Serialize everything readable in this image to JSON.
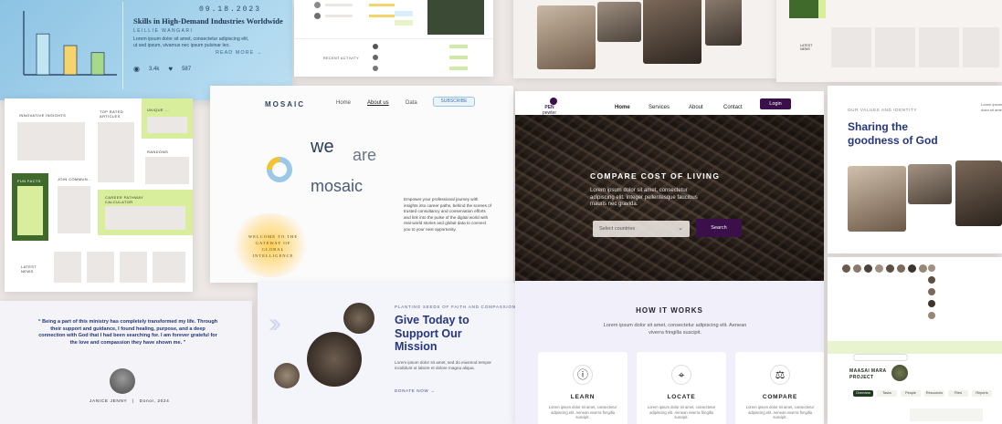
{
  "colors": {
    "navy": "#27367c",
    "plum": "#3a0f4a",
    "lime": "#d9ee9c",
    "forest": "#3f6a2b",
    "sky": "#8cc3e3",
    "amber": "#ffd15a"
  },
  "article_card": {
    "date": "09.18.2023",
    "title": "Skills in High-Demand Industries Worldwide",
    "author": "LEILLIE WANGARI",
    "excerpt": "Lorem ipsum dolor sit amet, consectetur adipiscing elit, ut sed ipsum, vivamus nec ipsum pulvinar leo.",
    "read_more": "READ MORE",
    "views": "3.4k",
    "likes": "587",
    "chart_bars": [
      {
        "name": "bar-teal",
        "level": 0.7,
        "color": "#bfe6f2"
      },
      {
        "name": "bar-yellow",
        "level": 0.5,
        "color": "#f6d46b"
      },
      {
        "name": "bar-green",
        "level": 0.38,
        "color": "#a8d88a"
      }
    ]
  },
  "dashboard_top": {
    "section_label": "RECENT ACTIVITY"
  },
  "left_grid": {
    "labels": [
      "INNOVATIVE INSIGHTS",
      "TOP RATED ARTICLES",
      "UNIQUE ...",
      "FUN FACTS",
      "JOIN COMMUN...",
      "RANDOMS",
      "CAREER PATHWAY CALCULATOR",
      "LATEST NEWS"
    ]
  },
  "mosaic": {
    "logo": "MOSAIC",
    "nav": [
      "Home",
      "About us",
      "Data"
    ],
    "subscribe": "SUBSCRIBE",
    "headline_we": "we",
    "headline_are": "are",
    "headline_mosaic": "mosaic",
    "body": "Empower your professional journey with insights into career paths, behind the scenes of trusted consultancy and conservation efforts and link into the pulse of the digital world with real-world stories and global data to connect you to your next opportunity.",
    "welcome": "WELCOME TO THE GATEWAY OF GLOBAL INTELLIGENCE",
    "top_grid_label": "LATEST NEWS"
  },
  "testimonial": {
    "quote": "“ Being a part of this ministry has completely transformed my life. Through their support and guidance, I found healing, purpose, and a deep connection with God that I had been searching for. I am forever grateful for the love and compassion they have shown me. ”",
    "name": "JANICE JENNY",
    "role": "Donor, 2024"
  },
  "give": {
    "kicker": "PLANTING SEEDS OF FAITH AND COMPASSION",
    "heading": "Give Today to Support Our Mission",
    "body": "Lorem ipsum dolor sit amet, sed do eiusmod tempor incididunt ut labore et dolore magna aliqua.",
    "link": "DONATE NOW"
  },
  "open_country": {
    "brand_line1": "PEN",
    "brand_line2": "pewter",
    "nav": [
      "Home",
      "Services",
      "About",
      "Contact"
    ],
    "login": "Login",
    "hero_title": "COMPARE COST OF LIVING",
    "hero_sub": "Lorem ipsum dolor sit amet, consectetur adipiscing elit. Integer pellentesque faucibus mauris nec gravida.",
    "select_placeholder": "Select countries",
    "search": "Search",
    "how_title": "HOW IT WORKS",
    "how_sub": "Lorem ipsum dolor sit amet, consectetur adipiscing elit. Aenean viverra fringilla suscipit.",
    "steps": [
      {
        "title": "LEARN",
        "icon": "info-icon",
        "glyph": "ⓘ",
        "desc": "Lorem ipsum dolor sit amet, consectetur adipiscing elit. Aenean viverra fringilla suscipit."
      },
      {
        "title": "LOCATE",
        "icon": "crosshair-icon",
        "glyph": "⌖",
        "desc": "Lorem ipsum dolor sit amet, consectetur adipiscing elit. Aenean viverra fringilla suscipit."
      },
      {
        "title": "COMPARE",
        "icon": "scale-icon",
        "glyph": "⚖",
        "desc": "Lorem ipsum dolor sit amet, consectetur adipiscing elit. Aenean viverra fringilla suscipit."
      }
    ]
  },
  "goodness": {
    "kicker": "OUR VALUES AND IDENTITY",
    "heading": "Sharing the goodness of God",
    "side": "Lorem ipsum dolor sit amet"
  },
  "dashboard_bottom": {
    "title": "MAASAI MARA PROJECT",
    "tabs": [
      "Overview",
      "Tasks",
      "People",
      "Resources",
      "Files",
      "Reports"
    ]
  }
}
